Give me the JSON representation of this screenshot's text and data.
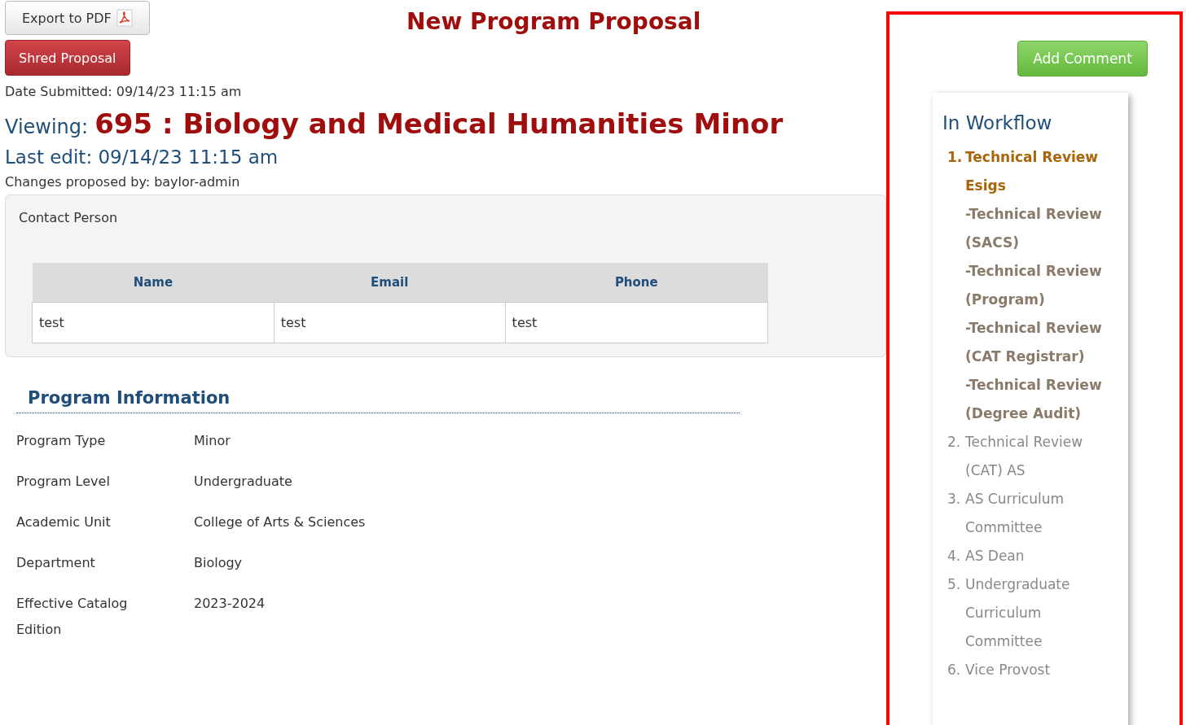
{
  "page_title": "New Program Proposal",
  "buttons": {
    "export": "Export to PDF",
    "shred": "Shred Proposal",
    "comment": "Add Comment"
  },
  "date_submitted": "Date Submitted: 09/14/23 11:15 am",
  "viewing": {
    "label": "Viewing:",
    "title": "695 : Biology and Medical Humanities Minor"
  },
  "last_edit": "Last edit: 09/14/23 11:15 am",
  "proposed_by": "Changes proposed by: baylor-admin",
  "contact": {
    "title": "Contact Person",
    "columns": [
      "Name",
      "Email",
      "Phone"
    ],
    "rows": [
      [
        "test",
        "test",
        "test"
      ]
    ]
  },
  "program_info": {
    "heading": "Program Information",
    "fields": [
      {
        "label": "Program Type",
        "value": "Minor"
      },
      {
        "label": "Program Level",
        "value": "Undergraduate"
      },
      {
        "label": "Academic Unit",
        "value": "College of Arts & Sciences"
      },
      {
        "label": "Department",
        "value": "Biology"
      },
      {
        "label": "Effective Catalog Edition",
        "value": "2023-2024"
      }
    ]
  },
  "workflow": {
    "title": "In Workflow",
    "steps": [
      {
        "number": "1.",
        "label": "Technical Review Esigs",
        "current": true,
        "children": [
          {
            "label": "-Technical Review (SACS)"
          },
          {
            "label": "-Technical Review (Program)"
          },
          {
            "label": "-Technical Review (CAT Registrar)"
          },
          {
            "label": "-Technical Review (Degree Audit)"
          }
        ]
      },
      {
        "number": "2.",
        "label": "Technical Review (CAT) AS",
        "current": false
      },
      {
        "number": "3.",
        "label": "AS Curriculum Committee",
        "current": false
      },
      {
        "number": "4.",
        "label": "AS Dean",
        "current": false
      },
      {
        "number": "5.",
        "label": "Undergraduate Curriculum Committee",
        "current": false
      },
      {
        "number": "6.",
        "label": "Vice Provost",
        "current": false
      }
    ]
  }
}
